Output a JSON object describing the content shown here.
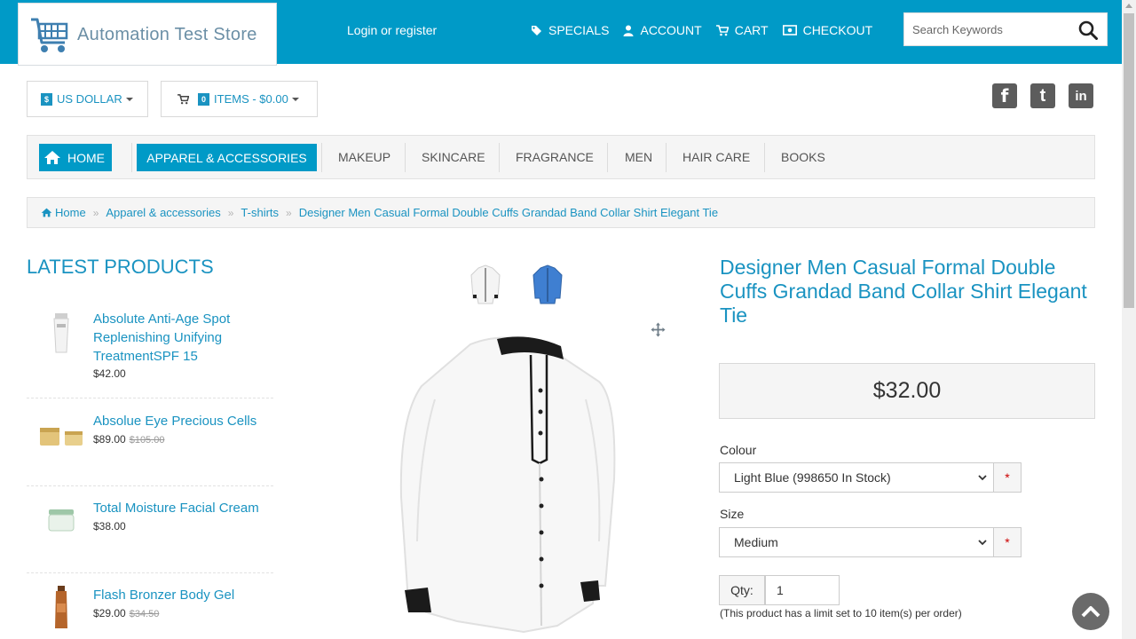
{
  "header": {
    "logo_text": "Automation Test Store",
    "login_label": "Login or register",
    "nav": [
      {
        "label": "SPECIALS",
        "icon": "tag-icon"
      },
      {
        "label": "ACCOUNT",
        "icon": "user-icon"
      },
      {
        "label": "CART",
        "icon": "cart-icon"
      },
      {
        "label": "CHECKOUT",
        "icon": "money-icon"
      }
    ],
    "search_placeholder": "Search Keywords",
    "bar_color": "#009ac7"
  },
  "toolbar": {
    "currency_symbol": "$",
    "currency_label": "US DOLLAR",
    "cart_count": "0",
    "cart_label": "ITEMS - $0.00"
  },
  "social": [
    "f",
    "t",
    "in"
  ],
  "categories": {
    "home": "HOME",
    "items": [
      "APPAREL & ACCESSORIES",
      "MAKEUP",
      "SKINCARE",
      "FRAGRANCE",
      "MEN",
      "HAIR CARE",
      "BOOKS"
    ]
  },
  "breadcrumb": [
    "Home",
    "Apparel & accessories",
    "T-shirts",
    "Designer Men Casual Formal Double Cuffs Grandad Band Collar Shirt Elegant Tie"
  ],
  "latest": {
    "title": "LATEST PRODUCTS",
    "products": [
      {
        "name": "Absolute Anti-Age Spot Replenishing Unifying TreatmentSPF 15",
        "price": "$42.00",
        "old": ""
      },
      {
        "name": "Absolue Eye Precious Cells",
        "price": "$89.00",
        "old": "$105.00"
      },
      {
        "name": "Total Moisture Facial Cream",
        "price": "$38.00",
        "old": ""
      },
      {
        "name": "Flash Bronzer Body Gel",
        "price": "$29.00",
        "old": "$34.50"
      }
    ]
  },
  "product": {
    "title": "Designer Men Casual Formal Double Cuffs Grandad Band Collar Shirt Elegant Tie",
    "price": "$32.00",
    "colour_label": "Colour",
    "colour_value": "Light Blue (998650 In Stock)",
    "size_label": "Size",
    "size_value": "Medium",
    "required_mark": "*",
    "qty_label": "Qty:",
    "qty_value": "1",
    "limit_note": "(This product has a limit set to 10 item(s) per order)"
  }
}
